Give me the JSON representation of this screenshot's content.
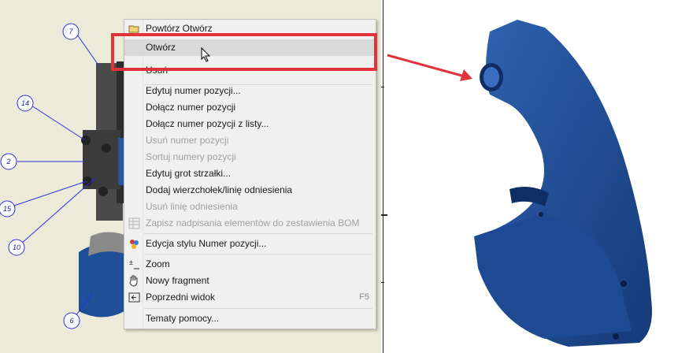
{
  "drawing": {
    "balloons": [
      "7",
      "14",
      "2",
      "15",
      "10",
      "6"
    ]
  },
  "context_menu": {
    "items": [
      {
        "label": "Powtórz Otwórz",
        "icon": "folder-open-icon",
        "enabled": true
      },
      {
        "label": "Otwórz",
        "enabled": true,
        "hovered": true
      },
      {
        "label": "Usuń",
        "enabled": true
      },
      {
        "label": "Edytuj numer pozycji...",
        "enabled": true
      },
      {
        "label": "Dołącz numer pozycji",
        "enabled": true
      },
      {
        "label": "Dołącz numer pozycji z listy...",
        "enabled": true
      },
      {
        "label": "Usuń numer pozycji",
        "enabled": false
      },
      {
        "label": "Sortuj numery pozycji",
        "enabled": false
      },
      {
        "label": "Edytuj grot strzałki...",
        "enabled": true
      },
      {
        "label": "Dodaj wierzchołek/linię odniesienia",
        "enabled": true
      },
      {
        "label": "Usuń linię odniesienia",
        "enabled": false
      },
      {
        "label": "Zapisz nadpisania elementów do zestawienia BOM",
        "icon": "bom-table-icon",
        "enabled": false
      },
      {
        "label": "Edycja stylu Numer pozycji...",
        "icon": "style-palette-icon",
        "enabled": true
      },
      {
        "label": "Zoom",
        "icon": "zoom-icon",
        "enabled": true
      },
      {
        "label": "Nowy fragment",
        "icon": "pan-hand-icon",
        "enabled": true
      },
      {
        "label": "Poprzedni widok",
        "icon": "previous-view-icon",
        "shortcut": "F5",
        "enabled": true
      },
      {
        "label": "Tematy pomocy...",
        "enabled": true
      }
    ]
  },
  "colors": {
    "highlight": "#e0343a",
    "part_blue": "#1f4f96",
    "balloon_blue": "#1a1aa8",
    "canvas_bg": "#ecebd9"
  }
}
